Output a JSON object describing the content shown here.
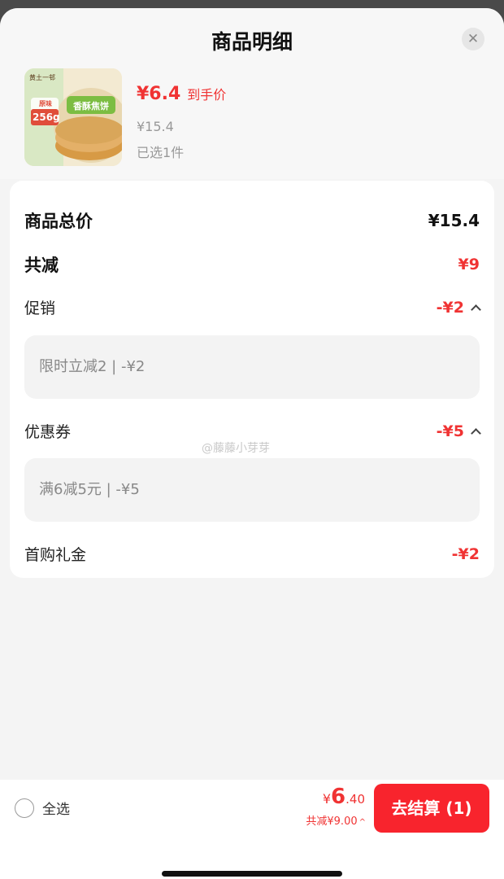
{
  "header": {
    "title": "商品明细",
    "close_icon": "close-icon"
  },
  "product": {
    "price_now": "¥6.4",
    "price_tag": "到手价",
    "original_price": "¥15.4",
    "selected": "已选1件",
    "image_text": {
      "brand": "黄土一邨",
      "flavor": "原味",
      "name": "香酥焦饼",
      "weight": "256g"
    }
  },
  "summary": {
    "total_label": "商品总价",
    "total_value": "¥15.4",
    "reduce_label": "共减",
    "reduce_value": "¥9",
    "promo_label": "促销",
    "promo_value": "-¥2",
    "promo_detail": "限时立减2 | -¥2",
    "coupon_label": "优惠券",
    "coupon_value": "-¥5",
    "coupon_detail": "满6减5元 | -¥5",
    "gift_label": "首购礼金",
    "gift_value": "-¥2"
  },
  "watermark": "@藤藤小芽芽",
  "footer": {
    "select_all": "全选",
    "currency": "¥",
    "total_int": "6",
    "total_dec": ".40",
    "saved": "共减¥9.00",
    "checkout": "去结算 (1)"
  },
  "colors": {
    "accent": "#f03333",
    "button": "#f8242d"
  }
}
